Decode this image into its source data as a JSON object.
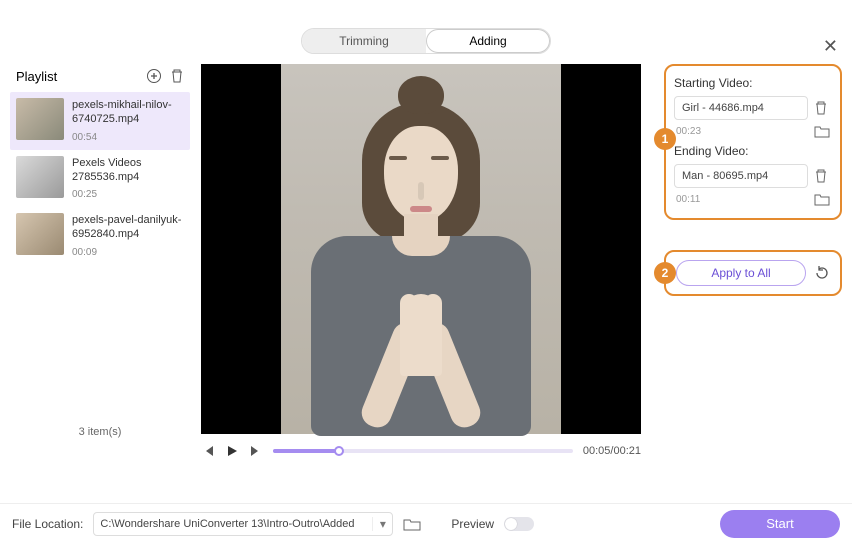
{
  "close_label": "✕",
  "tabs": {
    "trimming": "Trimming",
    "adding": "Adding"
  },
  "playlist": {
    "title": "Playlist",
    "count_label": "3 item(s)",
    "items": [
      {
        "name": "pexels-mikhail-nilov-6740725.mp4",
        "duration": "00:54"
      },
      {
        "name": "Pexels Videos 2785536.mp4",
        "duration": "00:25"
      },
      {
        "name": "pexels-pavel-danilyuk-6952840.mp4",
        "duration": "00:09"
      }
    ]
  },
  "player": {
    "time": "00:05/00:21"
  },
  "panel": {
    "badge1": "1",
    "starting_label": "Starting Video:",
    "starting_file": "Girl - 44686.mp4",
    "starting_dur": "00:23",
    "ending_label": "Ending Video:",
    "ending_file": "Man - 80695.mp4",
    "ending_dur": "00:11",
    "badge2": "2",
    "apply_label": "Apply to All"
  },
  "footer": {
    "location_label": "File Location:",
    "location_value": "C:\\Wondershare UniConverter 13\\Intro-Outro\\Added",
    "preview_label": "Preview",
    "start_label": "Start"
  }
}
